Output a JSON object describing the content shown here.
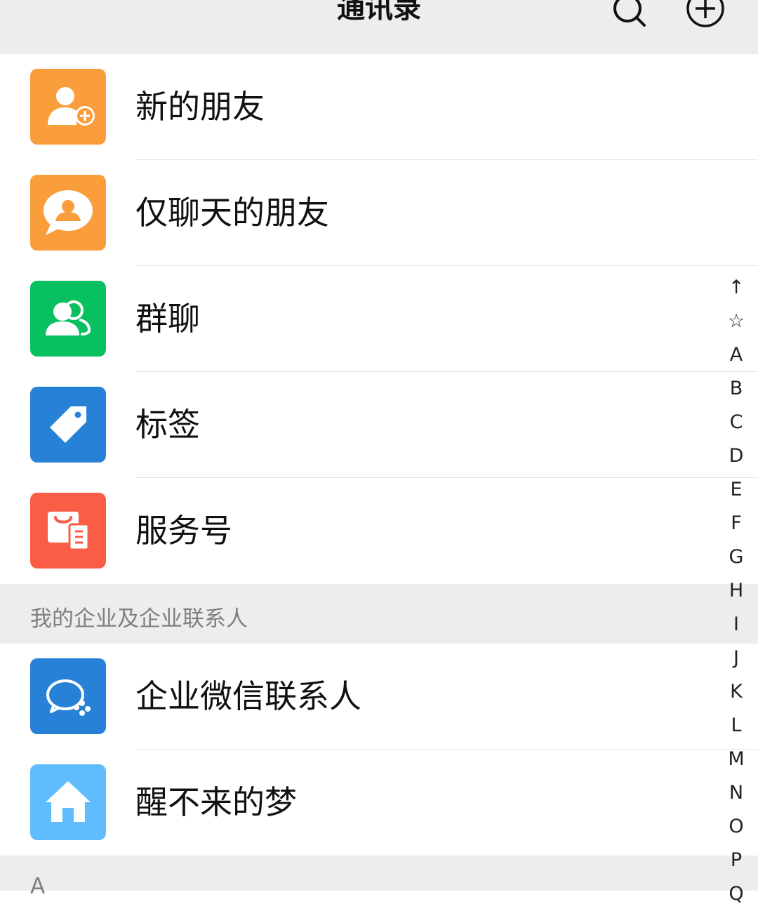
{
  "header": {
    "title": "通讯录"
  },
  "entries": [
    {
      "label": "新的朋友",
      "icon": "new-friend-icon",
      "color": "#fa9d3b"
    },
    {
      "label": "仅聊天的朋友",
      "icon": "chat-only-friend-icon",
      "color": "#fa9d3b"
    },
    {
      "label": "群聊",
      "icon": "group-chat-icon",
      "color": "#07c160"
    },
    {
      "label": "标签",
      "icon": "tag-icon",
      "color": "#2782d7"
    },
    {
      "label": "服务号",
      "icon": "service-account-icon",
      "color": "#fa5c45"
    }
  ],
  "enterprise_section": {
    "title": "我的企业及企业联系人",
    "items": [
      {
        "label": "企业微信联系人",
        "icon": "wecom-contacts-icon",
        "color": "#2782d7"
      },
      {
        "label": "醒不来的梦",
        "icon": "home-icon",
        "color": "#5fbdfe"
      }
    ]
  },
  "section_a": {
    "title": "A"
  },
  "index_bar": [
    "↑",
    "☆",
    "A",
    "B",
    "C",
    "D",
    "E",
    "F",
    "G",
    "H",
    "I",
    "J",
    "K",
    "L",
    "M",
    "N",
    "O",
    "P",
    "Q"
  ]
}
